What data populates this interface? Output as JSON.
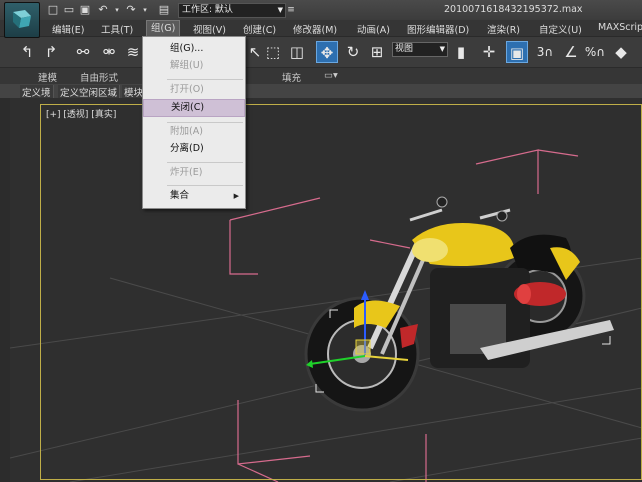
{
  "titlebar": {
    "workspace_label": "工作区: 默认",
    "file_name": "2010071618432195372.max"
  },
  "menubar": {
    "items": [
      "编辑(E)",
      "工具(T)",
      "组(G)",
      "视图(V)",
      "创建(C)",
      "修改器(M)",
      "动画(A)",
      "图形编辑器(D)",
      "渲染(R)",
      "自定义(U)",
      "MAXScript"
    ]
  },
  "toolbar": {
    "view_combo": "视图",
    "snap_label": "3",
    "percent_snap_label": "%"
  },
  "ribbon": {
    "tabs": [
      "建模",
      "自由形式",
      "填充"
    ],
    "row2": [
      "定义境",
      "定义空闲区域",
      "模块"
    ]
  },
  "viewport": {
    "label": "[+] [透视] [真实]"
  },
  "dropdown": {
    "items": [
      {
        "label": "组(G)...",
        "enabled": true
      },
      {
        "label": "解组(U)",
        "enabled": false
      },
      {
        "label": "打开(O)",
        "enabled": false
      },
      {
        "label": "关闭(C)",
        "enabled": true,
        "highlighted": true
      },
      {
        "label": "附加(A)",
        "enabled": false
      },
      {
        "label": "分离(D)",
        "enabled": true
      },
      {
        "label": "炸开(E)",
        "enabled": false
      },
      {
        "label": "集合",
        "enabled": true,
        "submenu": true
      }
    ]
  },
  "colors": {
    "accent_select": "#2d6fb0",
    "menu_highlight": "#cfc0d6",
    "viewport_border": "#bfae48",
    "bike_yellow": "#e8c61a",
    "bike_red": "#c0282a"
  }
}
